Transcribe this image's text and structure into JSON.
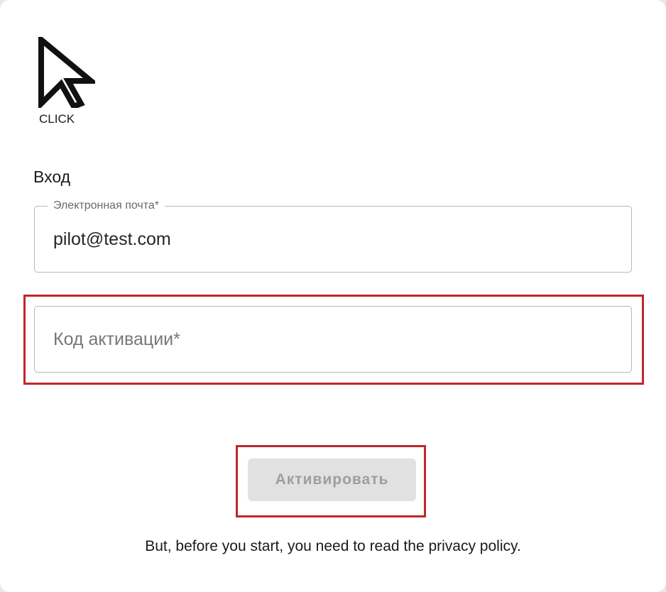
{
  "logo": {
    "icon": "cursor-arrow-icon",
    "text": "CLICK"
  },
  "form": {
    "title": "Вход",
    "email": {
      "label": "Электронная почта*",
      "value": "pilot@test.com"
    },
    "activation_code": {
      "placeholder": "Код активации*",
      "value": ""
    },
    "submit_label": "Активировать",
    "submit_enabled": false
  },
  "footer": {
    "note": "But, before you start, you need to read the privacy policy."
  },
  "colors": {
    "highlight": "#c0272d",
    "button_bg_disabled": "#e1e1e1",
    "button_text_disabled": "#9e9e9e",
    "field_border": "#b8b8b8"
  }
}
